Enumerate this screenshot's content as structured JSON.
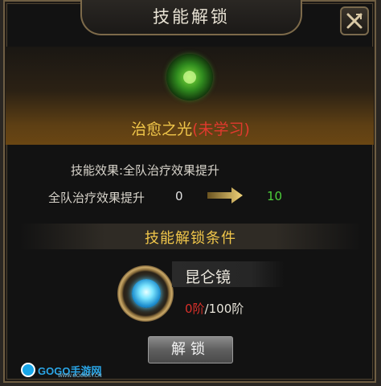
{
  "dialog": {
    "title": "技能解锁",
    "close_icon": "close-x-icon"
  },
  "skill": {
    "name": "治愈之光",
    "status": "(未学习)",
    "icon": "green-healing-orb-icon",
    "effect_label": "技能效果:全队治疗效果提升",
    "stat": {
      "name": "全队治疗效果提升",
      "current": "0",
      "next": "10",
      "arrow_icon": "right-arrow-icon"
    }
  },
  "condition": {
    "title": "技能解锁条件",
    "item_name": "昆仑镜",
    "item_icon": "kunlun-mirror-icon",
    "progress_current": "0阶",
    "progress_total": "/100阶"
  },
  "unlock_button": {
    "label": "解锁"
  },
  "watermark": {
    "text": "GOGO手游网",
    "url": "WWW.GOGOSY.CN"
  },
  "colors": {
    "accent_gold": "#f0c64a",
    "status_red": "#e03a2e",
    "value_green": "#4ccf3a"
  }
}
